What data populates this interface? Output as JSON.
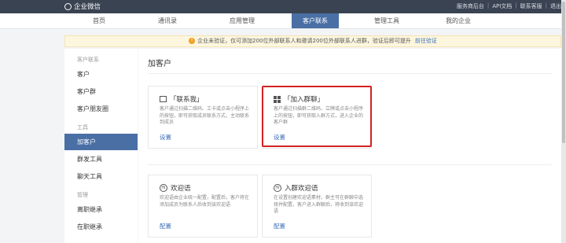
{
  "topbar": {
    "logo": "企业微信",
    "links": [
      "服务商后台",
      "API文档",
      "联系客服",
      "退出"
    ]
  },
  "nav": {
    "items": [
      "首页",
      "通讯录",
      "应用管理",
      "客户联系",
      "管理工具",
      "我的企业"
    ],
    "active_index": 3
  },
  "banner": {
    "text": "企业未验证，仅可添加200位外部联系人和邀请200位外部联系人进群，验证后即可提升",
    "link": "前往验证"
  },
  "sidebar": {
    "groups": [
      "客户联系",
      "工具",
      "管理"
    ],
    "items": [
      "客户",
      "客户群",
      "客户朋友圈",
      "加客户",
      "群发工具",
      "聊天工具",
      "离职继承",
      "在职继承"
    ],
    "active": "加客户"
  },
  "main": {
    "title": "加客户",
    "cards": [
      {
        "title": "「联系我」",
        "desc": "客户通过扫描二维码、工卡或点击小程序上的按钮，即可获取成员联系方式，主动联系到成员",
        "link": "设置",
        "icon": "contact-me-icon"
      },
      {
        "title": "「加入群聊」",
        "desc": "客户通过扫描群二维码、立牌或点击小程序上的按钮，即可获取入群方式，进入企业的客户群",
        "link": "设置",
        "icon": "qr-code-icon"
      },
      {
        "title": "欢迎语",
        "desc": "欢迎语由企业统一配置，配置后，客户将在添加成员为联系人后收到该欢迎语",
        "link": "配置",
        "icon": "welcome-icon"
      },
      {
        "title": "入群欢迎语",
        "desc": "在设置创建欢迎语素材，群主可在群聊中选择并配置，客户进入群聊后，将收到该欢迎语",
        "link": "配置",
        "icon": "group-welcome-icon"
      }
    ]
  },
  "colors": {
    "active": "#4a6fa5",
    "highlight": "#d32222",
    "topbar": "#3a4352"
  }
}
